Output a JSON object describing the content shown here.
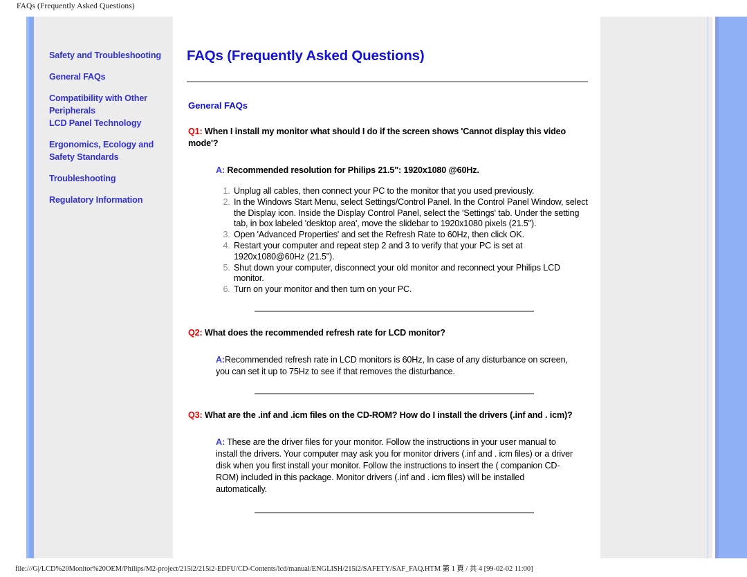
{
  "browser": {
    "header_title": "FAQs (Frequently Asked Questions)",
    "footer_path": "file:///G|/LCD%20Monitor%20OEM/Philips/M2-project/215i2/215i2-EDFU/CD-Contents/lcd/manual/ENGLISH/215i2/SAFETY/SAF_FAQ.HTM 第 1 頁 / 共 4 [99-02-02 11:00]"
  },
  "colors": {
    "link_blue": "#3333CC",
    "title_blue": "#1414D2",
    "question_red": "#EE0000",
    "answer_blue": "#3F3FE0",
    "panel_gray": "#ECECEC",
    "accent_blue": "#86A9F4",
    "right_blue": "#90B0F6",
    "rule_gray": "#8C8C8C"
  },
  "sidebar": {
    "groups": [
      {
        "items": [
          "Safety and Troubleshooting"
        ]
      },
      {
        "items": [
          "General FAQs"
        ]
      },
      {
        "items": [
          "Compatibility with Other Peripherals",
          "LCD Panel Technology"
        ]
      },
      {
        "items": [
          "Ergonomics, Ecology and Safety Standards"
        ]
      },
      {
        "items": [
          "Troubleshooting"
        ]
      },
      {
        "items": [
          "Regulatory Information"
        ]
      }
    ]
  },
  "main": {
    "title": "FAQs (Frequently Asked Questions)",
    "section_title": "General FAQs",
    "faqs": [
      {
        "tag": "Q1:",
        "question": "When I install my monitor what should I do if the screen shows 'Cannot display this video mode'?",
        "answer_tag": "A:",
        "answer_tag_space": " ",
        "answer": "Recommended resolution for Philips 21.5\": 1920x1080 @60Hz.",
        "answer_bold": true,
        "steps": [
          "Unplug all cables, then connect your PC to the monitor that you used previously.",
          "In the Windows Start Menu, select Settings/Control Panel. In the Control Panel Window, select the Display icon. Inside the Display Control Panel, select the 'Settings' tab. Under the setting tab, in box labeled 'desktop area', move the slidebar to 1920x1080 pixels (21.5\").",
          "Open 'Advanced Properties' and set the Refresh Rate to 60Hz, then click OK.",
          "Restart your computer and repeat step 2 and 3 to verify that your PC is set at 1920x1080@60Hz (21.5\").",
          "Shut down your computer, disconnect your old monitor and reconnect your Philips LCD monitor.",
          "Turn on your monitor and then turn on your PC."
        ]
      },
      {
        "tag": "Q2:",
        "question": "What does the recommended refresh rate for LCD monitor?",
        "answer_tag": "A:",
        "answer_tag_space": "",
        "answer": "Recommended refresh rate in LCD monitors is 60Hz, In case of any disturbance on screen, you can set it up to 75Hz to see if that removes the disturbance.",
        "answer_bold": false,
        "steps": []
      },
      {
        "tag": "Q3:",
        "question": "What are the .inf and .icm files on the CD-ROM? How do I install the drivers (.inf and . icm)?",
        "answer_tag": "A:",
        "answer_tag_space": " ",
        "answer": "These are the driver files for your monitor. Follow the instructions in your user manual to install the drivers. Your computer may ask you for monitor drivers (.inf and . icm files) or a driver disk when you first install your monitor. Follow the instructions to insert the ( companion CD-ROM) included in this package. Monitor drivers (.inf and . icm files) will be installed automatically.",
        "answer_bold": false,
        "steps": []
      }
    ]
  }
}
